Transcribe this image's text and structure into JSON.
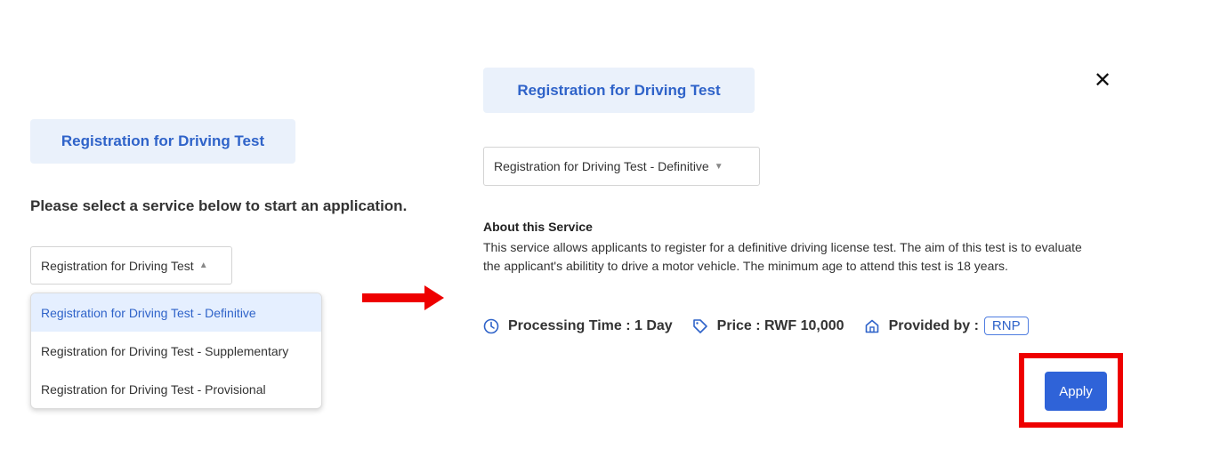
{
  "left_panel": {
    "service_tag": "Registration for Driving Test",
    "prompt": "Please select a service below to start an application.",
    "select_value": "Registration for Driving Test",
    "options": [
      "Registration for Driving Test - Definitive",
      "Registration for Driving Test - Supplementary",
      "Registration for Driving Test - Provisional"
    ],
    "active_option_index": 0
  },
  "right_panel": {
    "service_tag": "Registration for Driving Test",
    "select_value": "Registration for Driving Test - Definitive",
    "about_title": "About this Service",
    "about_text": "This service allows applicants to register for a definitive driving license test. The aim of this test is to evaluate the applicant's abilitity to drive a motor vehicle. The minimum age to attend this test is 18 years.",
    "processing_time": "Processing Time : 1 Day",
    "price": "Price : RWF 10,000",
    "provided_by_label": "Provided by :",
    "provider": "RNP",
    "apply_label": "Apply",
    "close_icon": "close-icon"
  },
  "annotations": {
    "arrow_color": "#ee0000",
    "highlight_color": "#ee0000"
  },
  "colors": {
    "accent": "#2f63c9",
    "tag_bg": "#eaf1fb",
    "apply_bg": "#2f63d8"
  }
}
